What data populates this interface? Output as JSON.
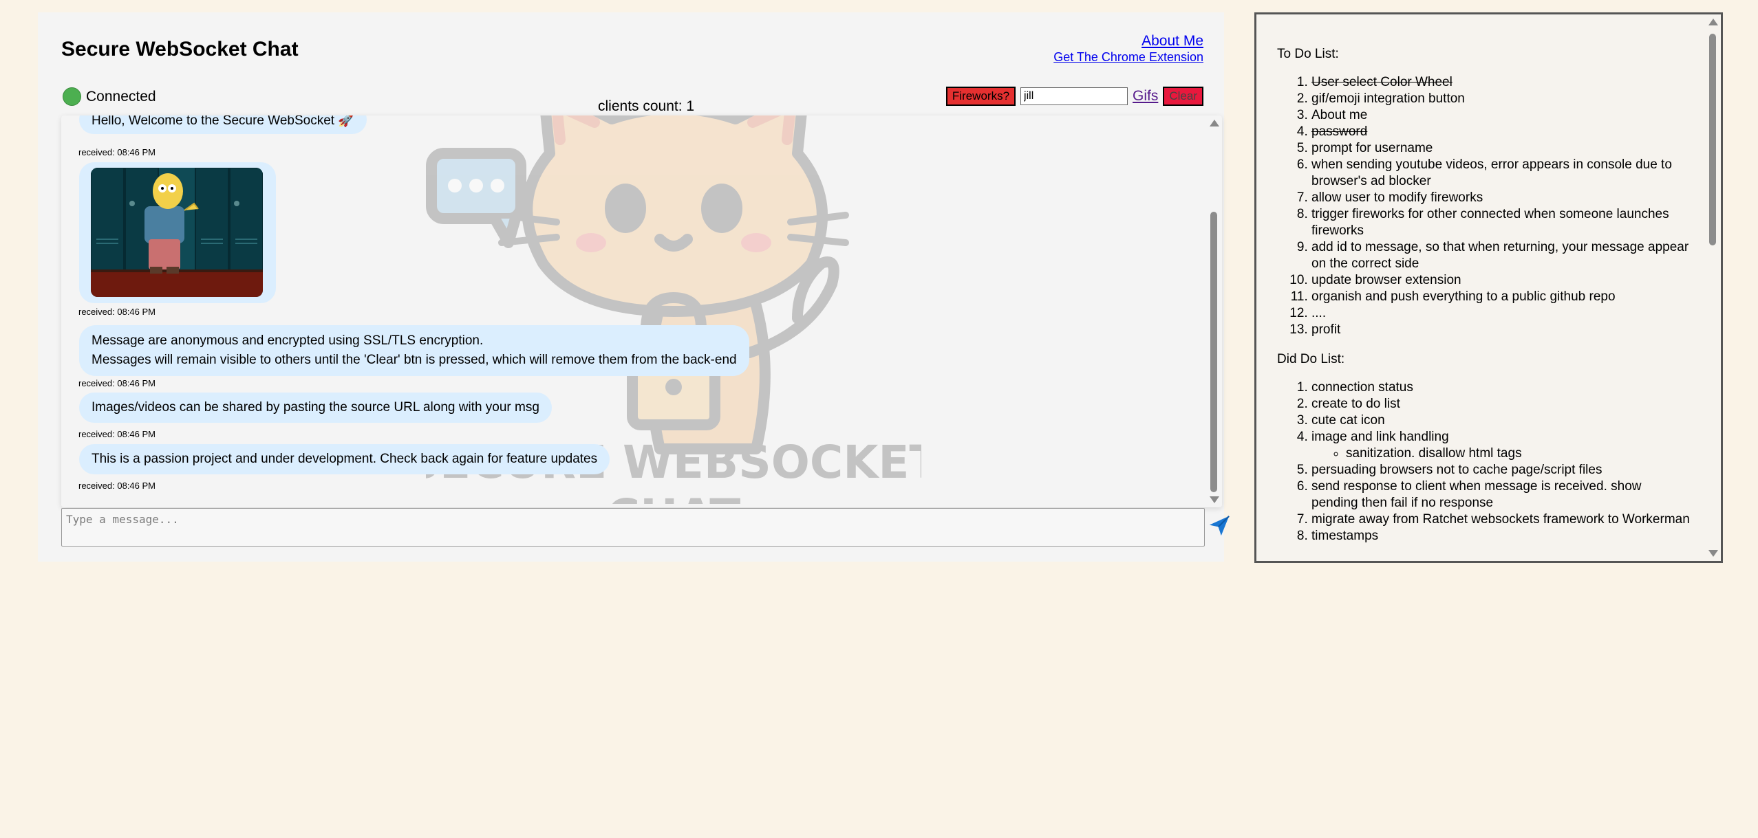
{
  "header": {
    "title": "Secure WebSocket Chat",
    "about_link": "About Me",
    "extension_link": "Get The Chrome Extension",
    "status": "Connected",
    "clients_count": "clients count: 1"
  },
  "controls": {
    "fireworks_label": "Fireworks?",
    "username_value": "jill",
    "gifs_label": "Gifs",
    "clear_label": "Clear"
  },
  "messages": [
    {
      "text": "Hello, Welcome to the Secure WebSocket 🚀",
      "timestamp": "received: 08:46 PM"
    },
    {
      "type": "image",
      "timestamp": "received: 08:46 PM"
    },
    {
      "lines": [
        "Message are anonymous and encrypted using SSL/TLS encryption.",
        "Messages will remain visible to others until the 'Clear' btn is pressed, which will remove them from the back-end"
      ],
      "timestamp": "received: 08:46 PM"
    },
    {
      "text": "Images/videos can be shared by pasting the source URL along with your msg",
      "timestamp": "received: 08:46 PM"
    },
    {
      "text": "This is a passion project and under development. Check back again for feature updates",
      "timestamp": "received: 08:46 PM"
    }
  ],
  "watermark_text": [
    "SECURE WEBSOCKET",
    "CHAT"
  ],
  "composer": {
    "placeholder": "Type a message..."
  },
  "todo": {
    "todo_heading": "To Do List:",
    "todo_items": [
      "User select Color Wheel",
      "gif/emoji integration button",
      "About me",
      "password",
      "prompt for username",
      "when sending youtube videos, error appears in console due to browser's ad blocker",
      "allow user to modify fireworks",
      "trigger fireworks for other connected when someone launches fireworks",
      "add id to message, so that when returning, your message appear on the correct side",
      "update browser extension",
      "organish and push everything to a public github repo",
      "....",
      "profit"
    ],
    "did_heading": "Did Do List:",
    "did_items": [
      "connection status",
      "create to do list",
      "cute cat icon",
      "image and link handling",
      "persuading browsers not to cache page/script files",
      "send response to client when message is received. show pending then fail if no response",
      "migrate away from Ratchet websockets framework to Workerman",
      "timestamps"
    ],
    "did_subitem": "sanitization. disallow html tags"
  },
  "colors": {
    "page_bg": "#faf3e7",
    "bubble": "#dbeefe",
    "status_green": "#4caf50",
    "fireworks_red": "#e53030",
    "clear_red": "#e8183d",
    "send_blue": "#1976d2"
  }
}
